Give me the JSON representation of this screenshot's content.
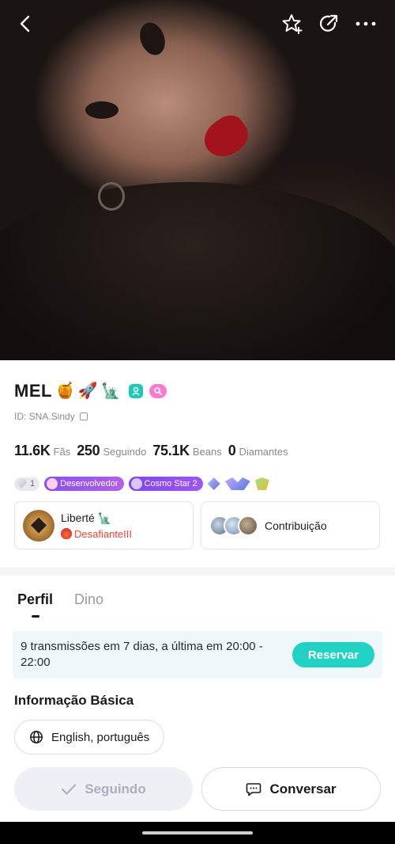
{
  "profile": {
    "name": "MEL",
    "name_emojis": [
      "🍯",
      "🚀",
      "🗽"
    ],
    "id_text": "ID: SNA.Sindy",
    "stats": [
      {
        "value": "11.6K",
        "label": "Fãs"
      },
      {
        "value": "250",
        "label": "Seguindo"
      },
      {
        "value": "75.1K",
        "label": "Beans"
      },
      {
        "value": "0",
        "label": "Diamantes"
      }
    ],
    "level": "1",
    "badges": {
      "developer": "Desenvolvedor",
      "cosmo": "Cosmo Star 2"
    }
  },
  "cards": {
    "rank_title": "Liberté 🗽",
    "rank_sub": "DesafianteIII",
    "contribution_label": "Contribuição"
  },
  "tabs": [
    "Perfil",
    "Dino"
  ],
  "schedule": {
    "text": "9 transmissões em 7 dias, a última em 20:00 - 22:00",
    "button": "Reservar"
  },
  "info": {
    "title": "Informação Básica",
    "languages": "English, português"
  },
  "actions": {
    "follow": "Seguindo",
    "chat": "Conversar"
  },
  "colors": {
    "accent": "#21d1c4",
    "rank_red": "#e5483c",
    "badge_purple": "#8a4df0"
  }
}
